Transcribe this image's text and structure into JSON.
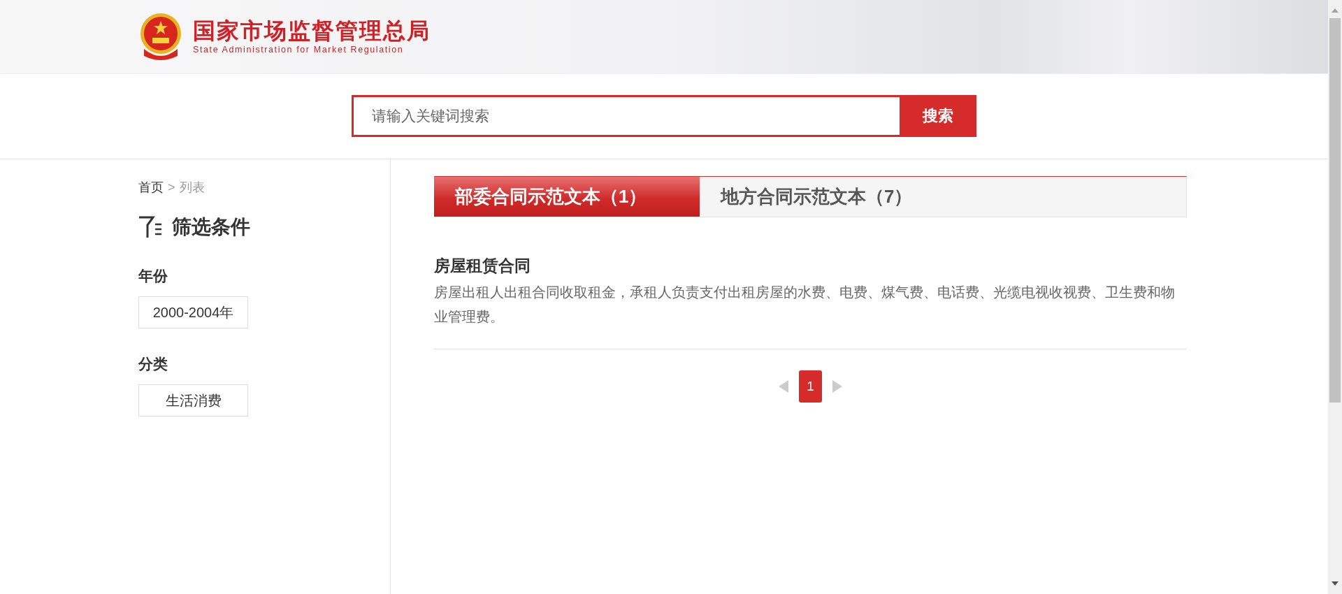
{
  "header": {
    "title": "国家市场监督管理总局",
    "subtitle": "State Administration for Market Regulation"
  },
  "search": {
    "placeholder": "请输入关键词搜索",
    "button": "搜索"
  },
  "breadcrumb": {
    "items": [
      {
        "label": "首页",
        "current": false
      },
      {
        "label": "列表",
        "current": true
      }
    ],
    "separator": ">"
  },
  "filters": {
    "title": "筛选条件",
    "groups": [
      {
        "label": "年份",
        "value": "2000-2004年"
      },
      {
        "label": "分类",
        "value": "生活消费"
      }
    ]
  },
  "tabs": [
    {
      "label": "部委合同示范文本（1）",
      "selected": true
    },
    {
      "label": "地方合同示范文本（7）",
      "selected": false
    }
  ],
  "results": [
    {
      "title": "房屋租赁合同",
      "description": "房屋出租人出租合同收取租金，承租人负责支付出租房屋的水费、电费、煤气费、电话费、光缆电视收视费、卫生费和物业管理费。"
    }
  ],
  "pagination": {
    "pages": [
      {
        "label": "1",
        "selected": true
      }
    ]
  }
}
